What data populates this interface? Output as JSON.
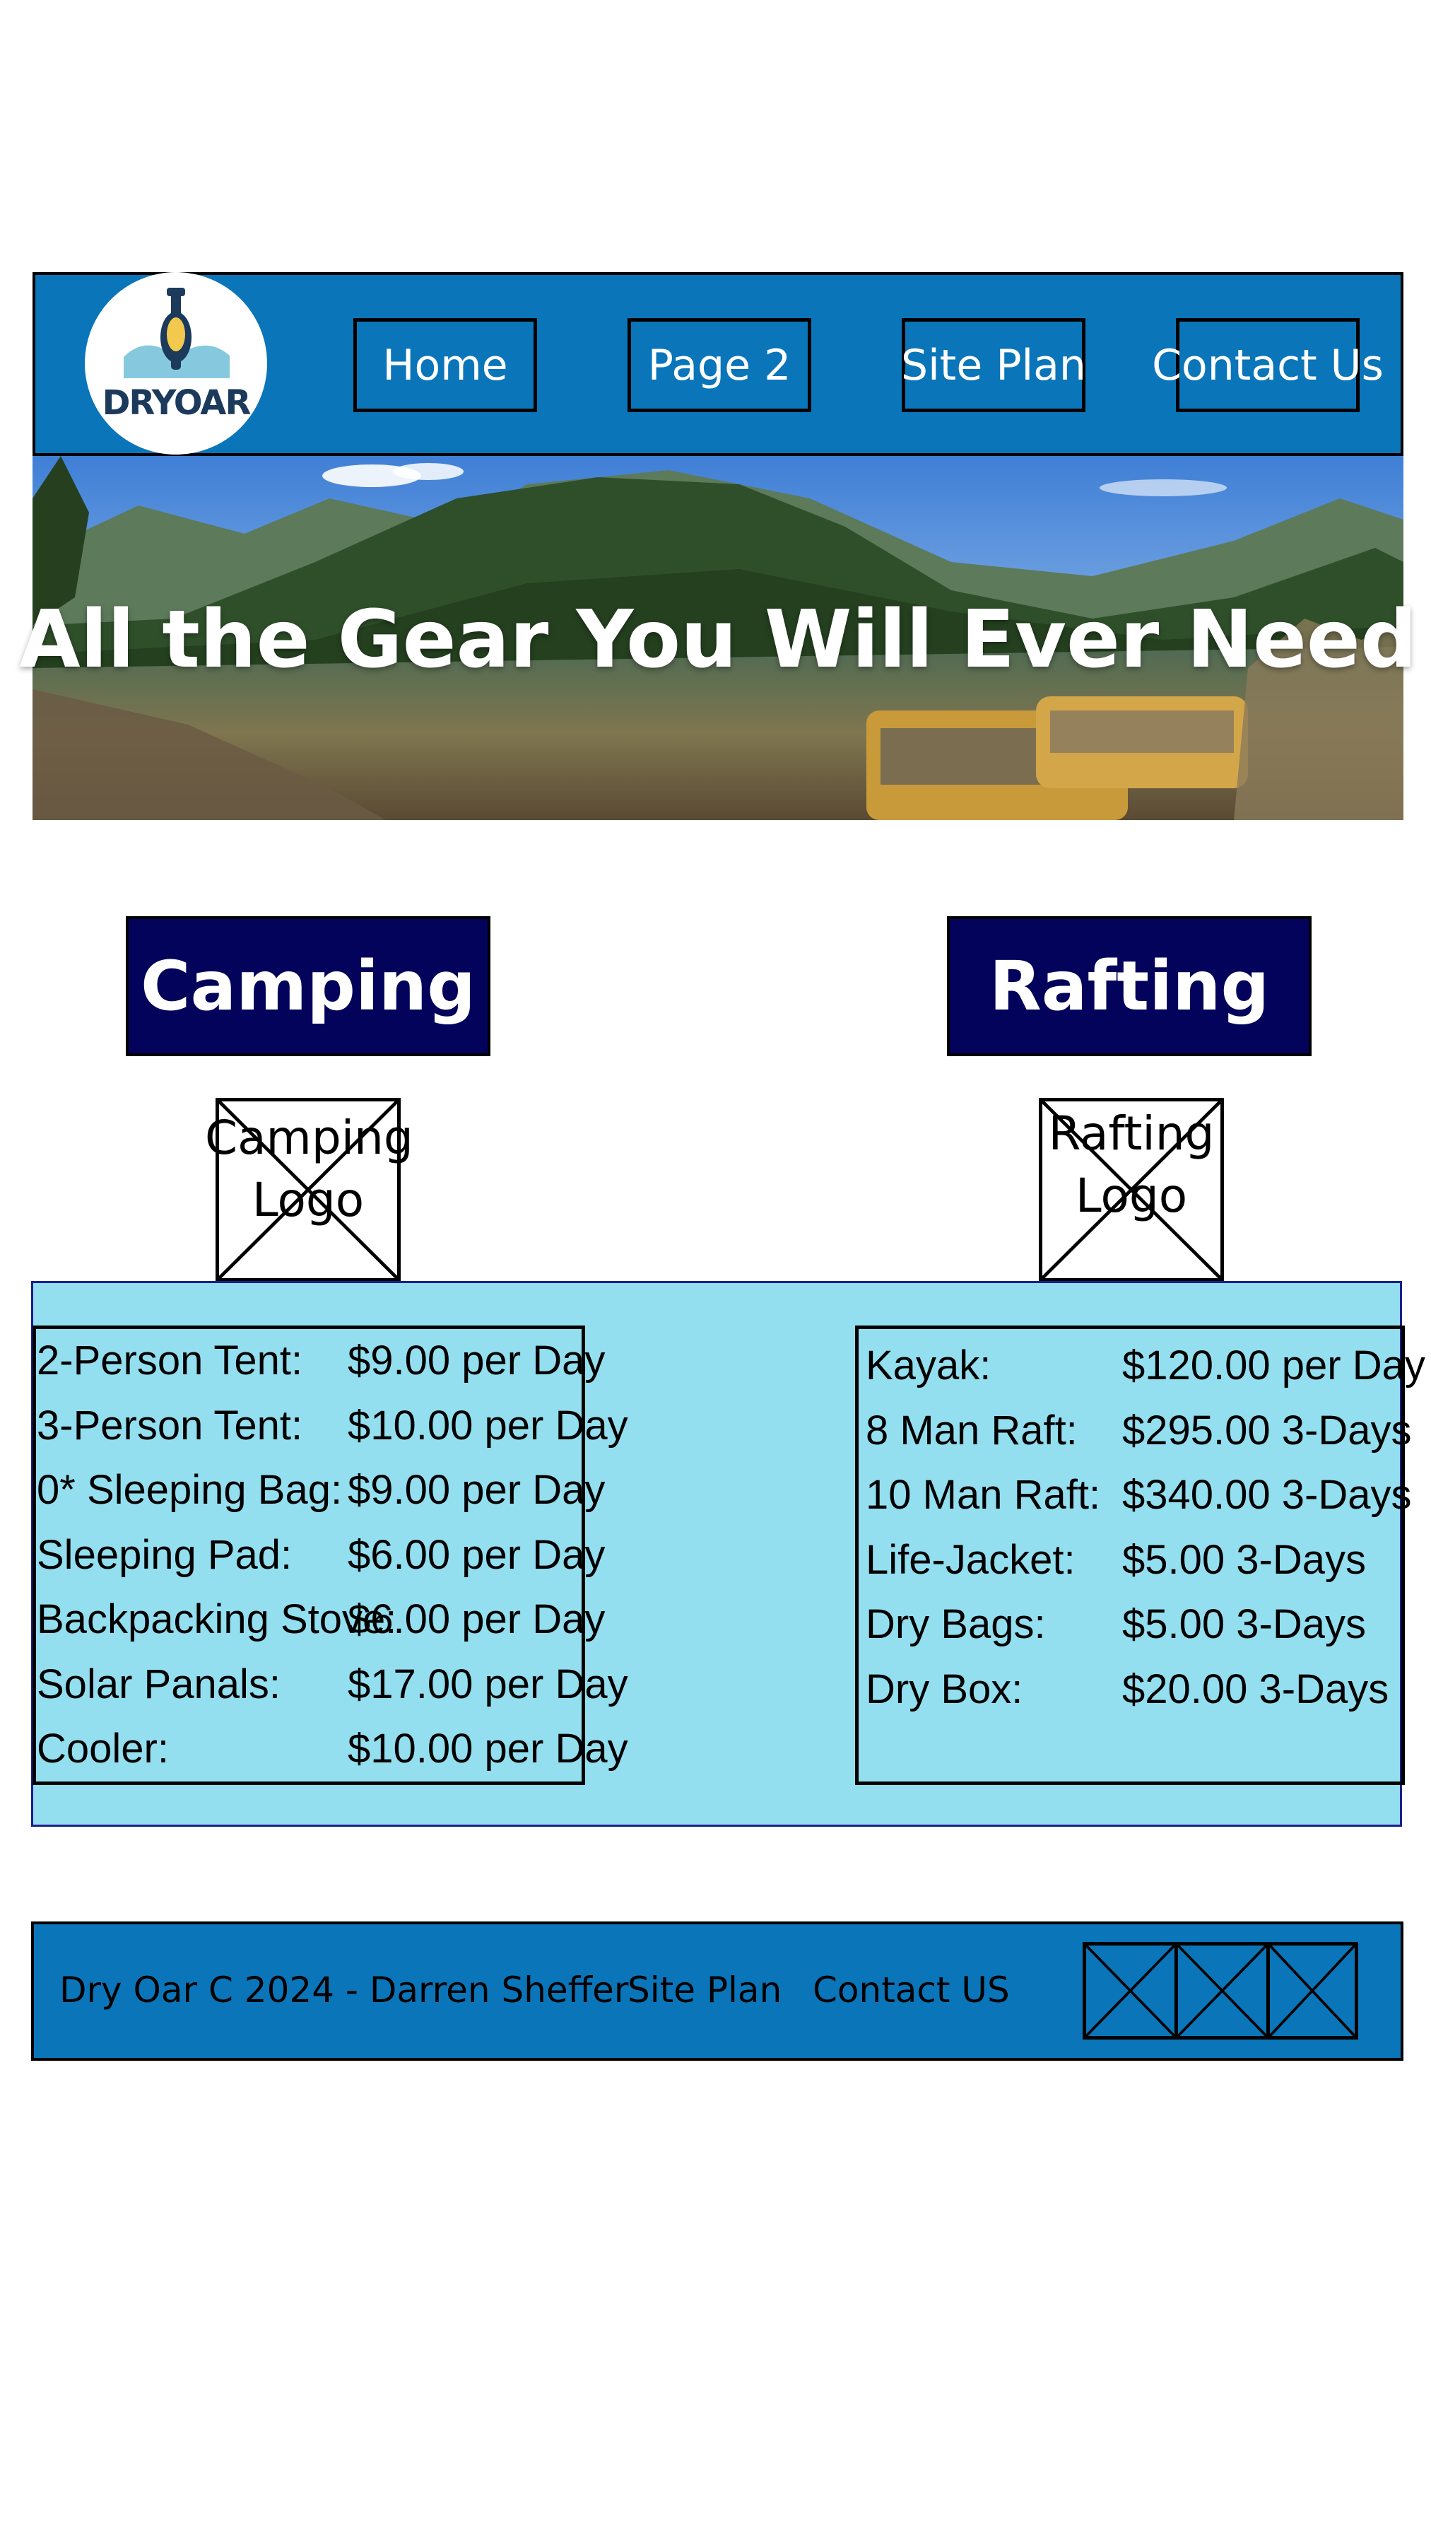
{
  "header": {
    "logo_text": "DRYOAR",
    "nav": [
      "Home",
      "Page 2",
      "Site Plan",
      "Contact Us"
    ]
  },
  "hero": {
    "title": "All the Gear You Will Ever Need"
  },
  "sections": {
    "camping": {
      "title": "Camping",
      "logo_placeholder": "Camping Logo",
      "items": [
        {
          "name": "2-Person Tent:",
          "price": "$9.00 per Day"
        },
        {
          "name": "3-Person Tent:",
          "price": "$10.00 per Day"
        },
        {
          "name": "0* Sleeping Bag:",
          "price": "$9.00 per Day"
        },
        {
          "name": "Sleeping Pad:",
          "price": "$6.00 per Day"
        },
        {
          "name": "Backpacking Stove:",
          "price": "$6.00 per Day"
        },
        {
          "name": "Solar Panals:",
          "price": "$17.00 per Day"
        },
        {
          "name": "Cooler:",
          "price": "$10.00 per Day"
        }
      ]
    },
    "rafting": {
      "title": "Rafting",
      "logo_placeholder": "Rafting Logo",
      "items": [
        {
          "name": "Kayak:",
          "price": "$120.00 per Day"
        },
        {
          "name": "8 Man Raft:",
          "price": "$295.00 3-Days"
        },
        {
          "name": "10 Man Raft:",
          "price": "$340.00 3-Days"
        },
        {
          "name": "Life-Jacket:",
          "price": "$5.00 3-Days"
        },
        {
          "name": "Dry Bags:",
          "price": "$5.00 3-Days"
        },
        {
          "name": "Dry Box:",
          "price": "$20.00 3-Days"
        }
      ]
    }
  },
  "footer": {
    "copyright": "Dry Oar C 2024 - Darren Sheffer",
    "site_plan": "Site Plan",
    "contact": "Contact US"
  },
  "colors": {
    "header_blue": "#0a75b9",
    "section_navy": "#03035b",
    "products_bg": "#93dff0",
    "logo_dark": "#1b3a5c",
    "logo_light": "#86c9de",
    "logo_yellow": "#f2c94c"
  }
}
